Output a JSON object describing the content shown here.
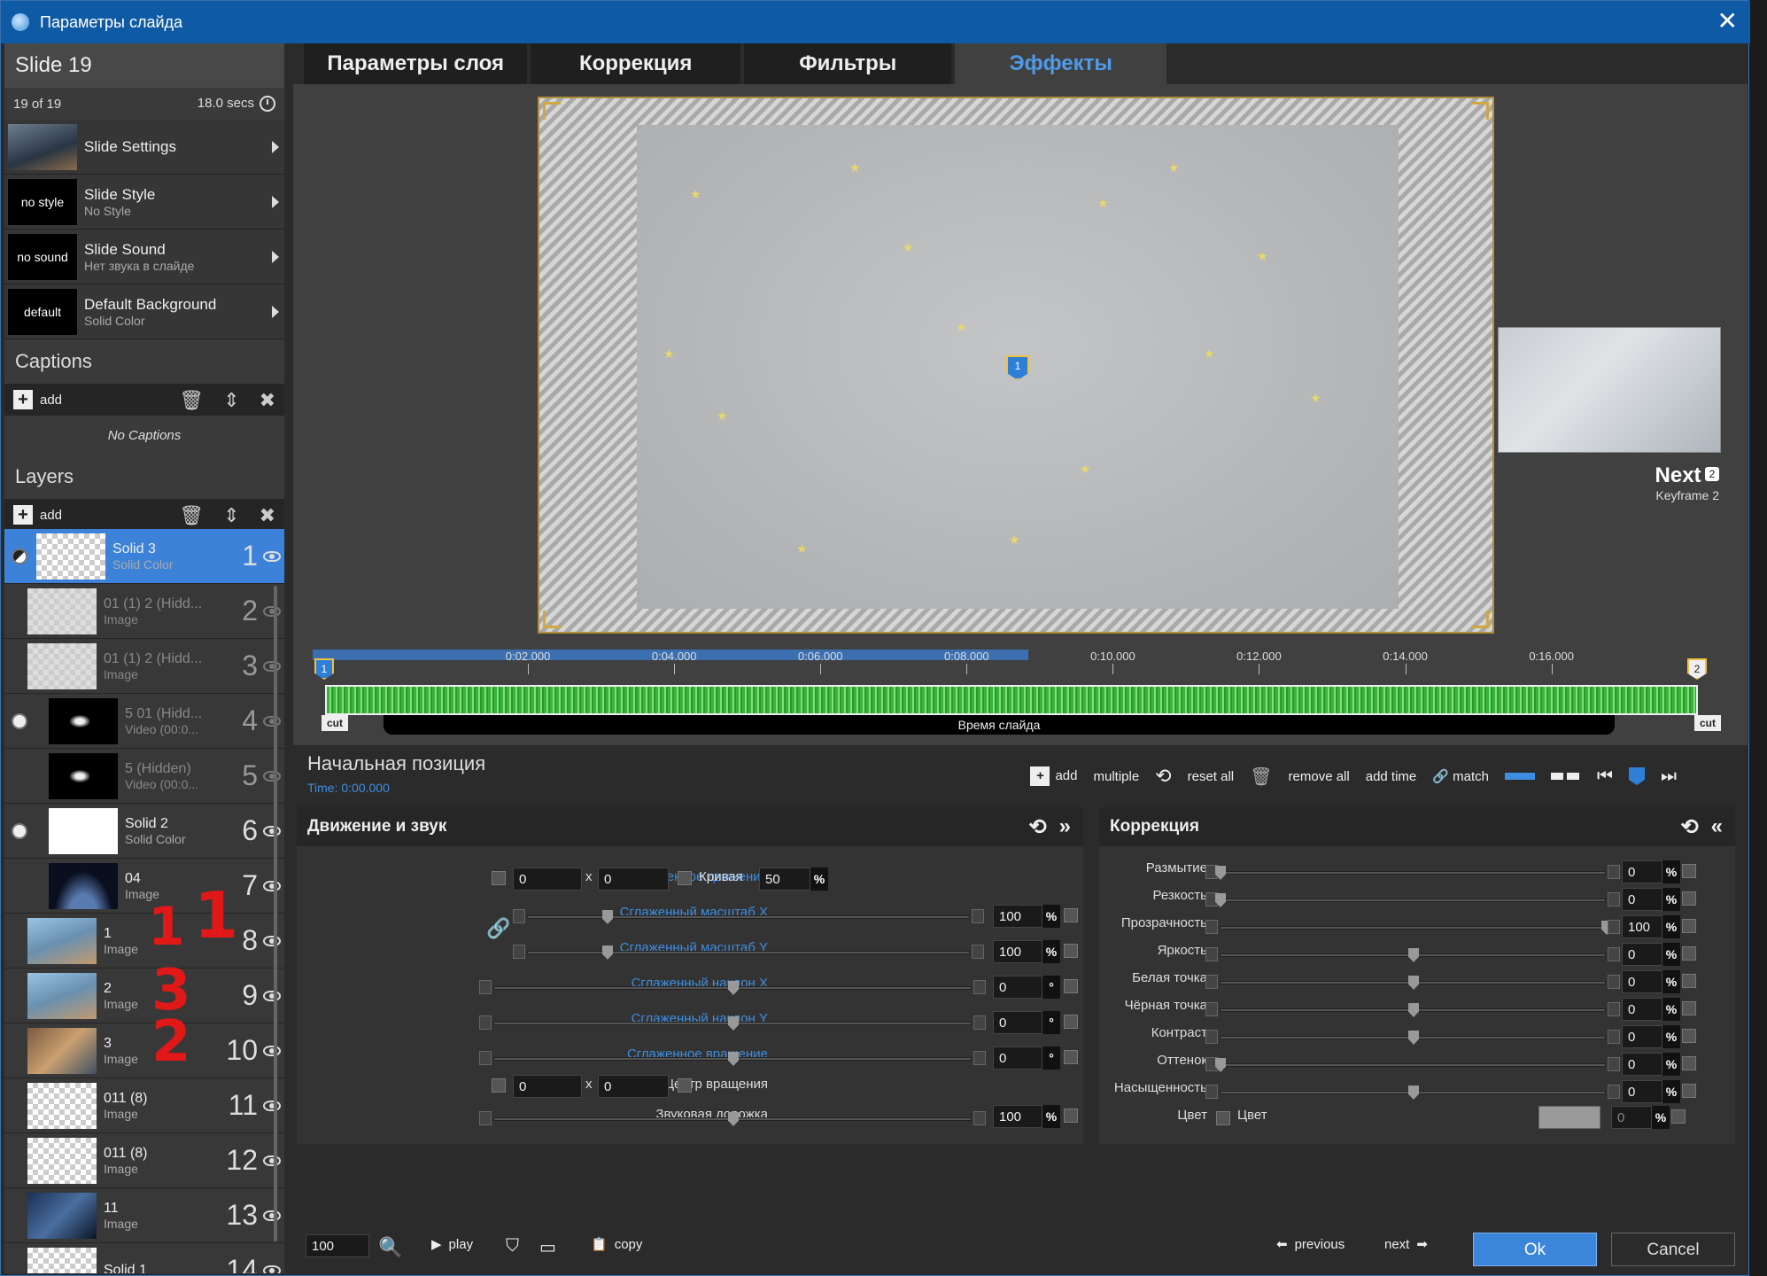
{
  "window": {
    "title": "Параметры слайда",
    "close": "✕"
  },
  "slide": {
    "title": "Slide 19",
    "position": "19 of 19",
    "duration": "18.0 secs"
  },
  "slide_settings": [
    {
      "thumb": "",
      "title": "Slide Settings",
      "subtitle": ""
    },
    {
      "thumb": "no style",
      "title": "Slide Style",
      "subtitle": "No Style"
    },
    {
      "thumb": "no sound",
      "title": "Slide Sound",
      "subtitle": "Нет звука в слайде"
    },
    {
      "thumb": "default",
      "title": "Default Background",
      "subtitle": "Solid Color"
    }
  ],
  "captions": {
    "title": "Captions",
    "add": "add",
    "empty": "No Captions"
  },
  "layers": {
    "title": "Layers",
    "add": "add",
    "items": [
      {
        "name": "Solid 3",
        "type": "Solid Color",
        "num": "1",
        "selected": true
      },
      {
        "name": "01 (1) 2 (Hidd...",
        "type": "Image",
        "num": "2"
      },
      {
        "name": "01 (1) 2 (Hidd...",
        "type": "Image",
        "num": "3"
      },
      {
        "name": "5 01 (Hidd...",
        "type": "Video (00:0...",
        "num": "4"
      },
      {
        "name": "5 (Hidden)",
        "type": "Video (00:0...",
        "num": "5"
      },
      {
        "name": "Solid 2",
        "type": "Solid Color",
        "num": "6"
      },
      {
        "name": "04",
        "type": "Image",
        "num": "7"
      },
      {
        "name": "1",
        "type": "Image",
        "num": "8"
      },
      {
        "name": "2",
        "type": "Image",
        "num": "9"
      },
      {
        "name": "3",
        "type": "Image",
        "num": "10"
      },
      {
        "name": "011 (8)",
        "type": "Image",
        "num": "11"
      },
      {
        "name": "011 (8)",
        "type": "Image",
        "num": "12"
      },
      {
        "name": "11",
        "type": "Image",
        "num": "13"
      },
      {
        "name": "Solid 1",
        "type": "",
        "num": "14"
      }
    ]
  },
  "tabs": [
    "Параметры слоя",
    "Коррекция",
    "Фильтры",
    "Эффекты"
  ],
  "preview": {
    "marker": "1",
    "next_label": "Next",
    "next_badge": "2",
    "next_sub": "Keyframe 2"
  },
  "timeline": {
    "start_marker": "1",
    "end_marker": "2",
    "ticks": [
      "0:02.000",
      "0:04.000",
      "0:06.000",
      "0:08.000",
      "0:10.000",
      "0:12.000",
      "0:14.000",
      "0:16.000"
    ],
    "cut": "cut",
    "slide_time": "Время слайда"
  },
  "keyframe": {
    "title": "Начальная позиция",
    "time": "Time: 0:00.000",
    "buttons": {
      "add": "add",
      "multiple": "multiple",
      "reset_all": "reset all",
      "remove_all": "remove all",
      "add_time": "add time",
      "match": "match"
    }
  },
  "motion": {
    "title": "Движение и звук",
    "smooth_motion": "Сглаженное движение",
    "pos_x": "0",
    "pos_y": "0",
    "x": "x",
    "curve_label": "Кривая",
    "curve_value": "50",
    "pct": "%",
    "scale_x": "Сглаженный масштаб X",
    "scale_x_val": "100",
    "scale_y": "Сглаженный масштаб Y",
    "scale_y_val": "100",
    "tilt_x": "Сглаженный наклон X",
    "tilt_x_val": "0",
    "tilt_y": "Сглаженный наклон Y",
    "tilt_y_val": "0",
    "rotation": "Сглаженное вращение",
    "rotation_val": "0",
    "deg": "°",
    "center": "Центр вращения",
    "center_x": "0",
    "center_y": "0",
    "audio": "Звуковая дорожка",
    "audio_val": "100"
  },
  "correction": {
    "title": "Коррекция",
    "rows": [
      {
        "label": "Размытие",
        "value": "0"
      },
      {
        "label": "Резкость",
        "value": "0"
      },
      {
        "label": "Прозрачность",
        "value": "100"
      },
      {
        "label": "Яркость",
        "value": "0"
      },
      {
        "label": "Белая точка",
        "value": "0"
      },
      {
        "label": "Чёрная точка",
        "value": "0"
      },
      {
        "label": "Контраст",
        "value": "0"
      },
      {
        "label": "Оттенок",
        "value": "0"
      },
      {
        "label": "Насыщенность",
        "value": "0"
      }
    ],
    "color_label": "Цвет",
    "color_check": "Цвет",
    "color_value": "0",
    "pct": "%"
  },
  "bottom": {
    "zoom": "100",
    "play": "play",
    "copy": "copy",
    "previous": "previous",
    "next": "next",
    "ok": "Ok",
    "cancel": "Cancel"
  },
  "annotations": [
    "1",
    "1",
    "3",
    "2"
  ]
}
